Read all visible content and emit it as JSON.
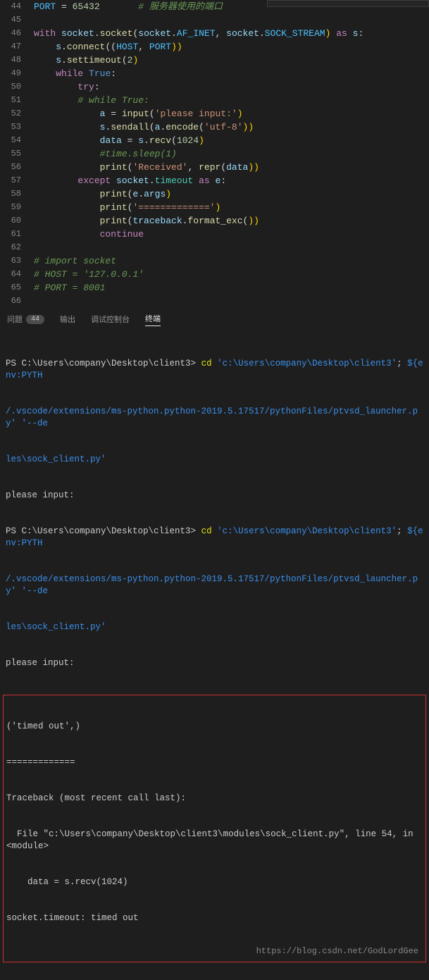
{
  "editor": {
    "lines": [
      {
        "num": "44",
        "html": "<span class='const'>PORT</span> <span class='op'>=</span> <span class='num'>65432</span>       <span class='cmt'># 服务器使用的端口</span>"
      },
      {
        "num": "45",
        "html": ""
      },
      {
        "num": "46",
        "html": "<span class='kw'>with</span> <span class='var'>socket</span><span class='pn'>.</span><span class='fn'>socket</span><span class='pn'>(</span><span class='var'>socket</span><span class='pn'>.</span><span class='const'>AF_INET</span><span class='pn'>,</span> <span class='var'>socket</span><span class='pn'>.</span><span class='const'>SOCK_STREAM</span><span class='pbrace'>)</span> <span class='kw'>as</span> <span class='var'>s</span><span class='pn'>:</span>"
      },
      {
        "num": "47",
        "html": "    <span class='var'>s</span><span class='pn'>.</span><span class='fn'>connect</span><span class='pn'>((</span><span class='const'>HOST</span><span class='pn'>,</span> <span class='const'>PORT</span><span class='pbrace'>))</span>"
      },
      {
        "num": "48",
        "html": "    <span class='var'>s</span><span class='pn'>.</span><span class='fn'>settimeout</span><span class='pn'>(</span><span class='num'>2</span><span class='pbrace'>)</span>"
      },
      {
        "num": "49",
        "html": "    <span class='kw'>while</span> <span class='dblue'>True</span><span class='pn'>:</span>"
      },
      {
        "num": "50",
        "html": "        <span class='kw'>try</span><span class='pn'>:</span>"
      },
      {
        "num": "51",
        "html": "        <span class='cmt'># while True:</span>"
      },
      {
        "num": "52",
        "html": "            <span class='var'>a</span> <span class='op'>=</span> <span class='fn'>input</span><span class='pn'>(</span><span class='str'>'please input:'</span><span class='pbrace'>)</span>"
      },
      {
        "num": "53",
        "html": "            <span class='var'>s</span><span class='pn'>.</span><span class='fn'>sendall</span><span class='pn'>(</span><span class='var'>a</span><span class='pn'>.</span><span class='fn'>encode</span><span class='pn'>(</span><span class='str'>'utf-8'</span><span class='pbrace'>))</span>"
      },
      {
        "num": "54",
        "html": "            <span class='var'>data</span> <span class='op'>=</span> <span class='var'>s</span><span class='pn'>.</span><span class='fn'>recv</span><span class='pn'>(</span><span class='num'>1024</span><span class='pbrace'>)</span>"
      },
      {
        "num": "55",
        "html": "            <span class='cmt'>#time.sleep(1)</span>"
      },
      {
        "num": "56",
        "html": "            <span class='fn'>print</span><span class='pn'>(</span><span class='str'>'Received'</span><span class='pn'>,</span> <span class='fn'>repr</span><span class='pn'>(</span><span class='var'>data</span><span class='pbrace'>))</span>"
      },
      {
        "num": "57",
        "html": "        <span class='kw'>except</span> <span class='var'>socket</span><span class='pn'>.</span><span class='cls'>timeout</span> <span class='kw'>as</span> <span class='var'>e</span><span class='pn'>:</span>"
      },
      {
        "num": "58",
        "html": "            <span class='fn'>print</span><span class='pn'>(</span><span class='var'>e</span><span class='pn'>.</span><span class='var'>args</span><span class='pbrace'>)</span>"
      },
      {
        "num": "59",
        "html": "            <span class='fn'>print</span><span class='pn'>(</span><span class='str'>'============='</span><span class='pbrace'>)</span>"
      },
      {
        "num": "60",
        "html": "            <span class='fn'>print</span><span class='pn'>(</span><span class='var'>traceback</span><span class='pn'>.</span><span class='fn'>format_exc</span><span class='pn'>(</span><span class='pbrace'>))</span>"
      },
      {
        "num": "61",
        "html": "            <span class='kw'>continue</span>"
      },
      {
        "num": "62",
        "html": ""
      },
      {
        "num": "63",
        "html": "<span class='cmt'># import socket</span>"
      },
      {
        "num": "64",
        "html": "<span class='cmt'># HOST = '127.0.0.1'</span>"
      },
      {
        "num": "65",
        "html": "<span class='cmt'># PORT = 8001</span>"
      },
      {
        "num": "66",
        "html": ""
      }
    ]
  },
  "panel": {
    "tabs": {
      "problems": "问题",
      "problems_count": "44",
      "output": "输出",
      "debug": "调试控制台",
      "terminal": "终端"
    }
  },
  "terminal": {
    "prompt": "PS C:\\Users\\company\\Desktop\\client3>",
    "cd": "cd",
    "path": "'c:\\Users\\company\\Desktop\\client3'",
    "semi": ";",
    "env": "${env:PYTH",
    "cont1": "/.vscode/extensions/ms-python.python-2019.5.17517/pythonFiles/ptvsd_launcher.py' '--de",
    "cont2": "les\\sock_client.py'",
    "prompt_text": "please input:",
    "err1": "('timed out',)",
    "err2": "=============",
    "err3": "Traceback (most recent call last):",
    "err4": "  File \"c:\\Users\\company\\Desktop\\client3\\modules\\sock_client.py\", line 54, in <module>",
    "err5": "    data = s.recv(1024)",
    "err6": "socket.timeout: timed out"
  },
  "watermark": "https://blog.csdn.net/GodLordGee"
}
